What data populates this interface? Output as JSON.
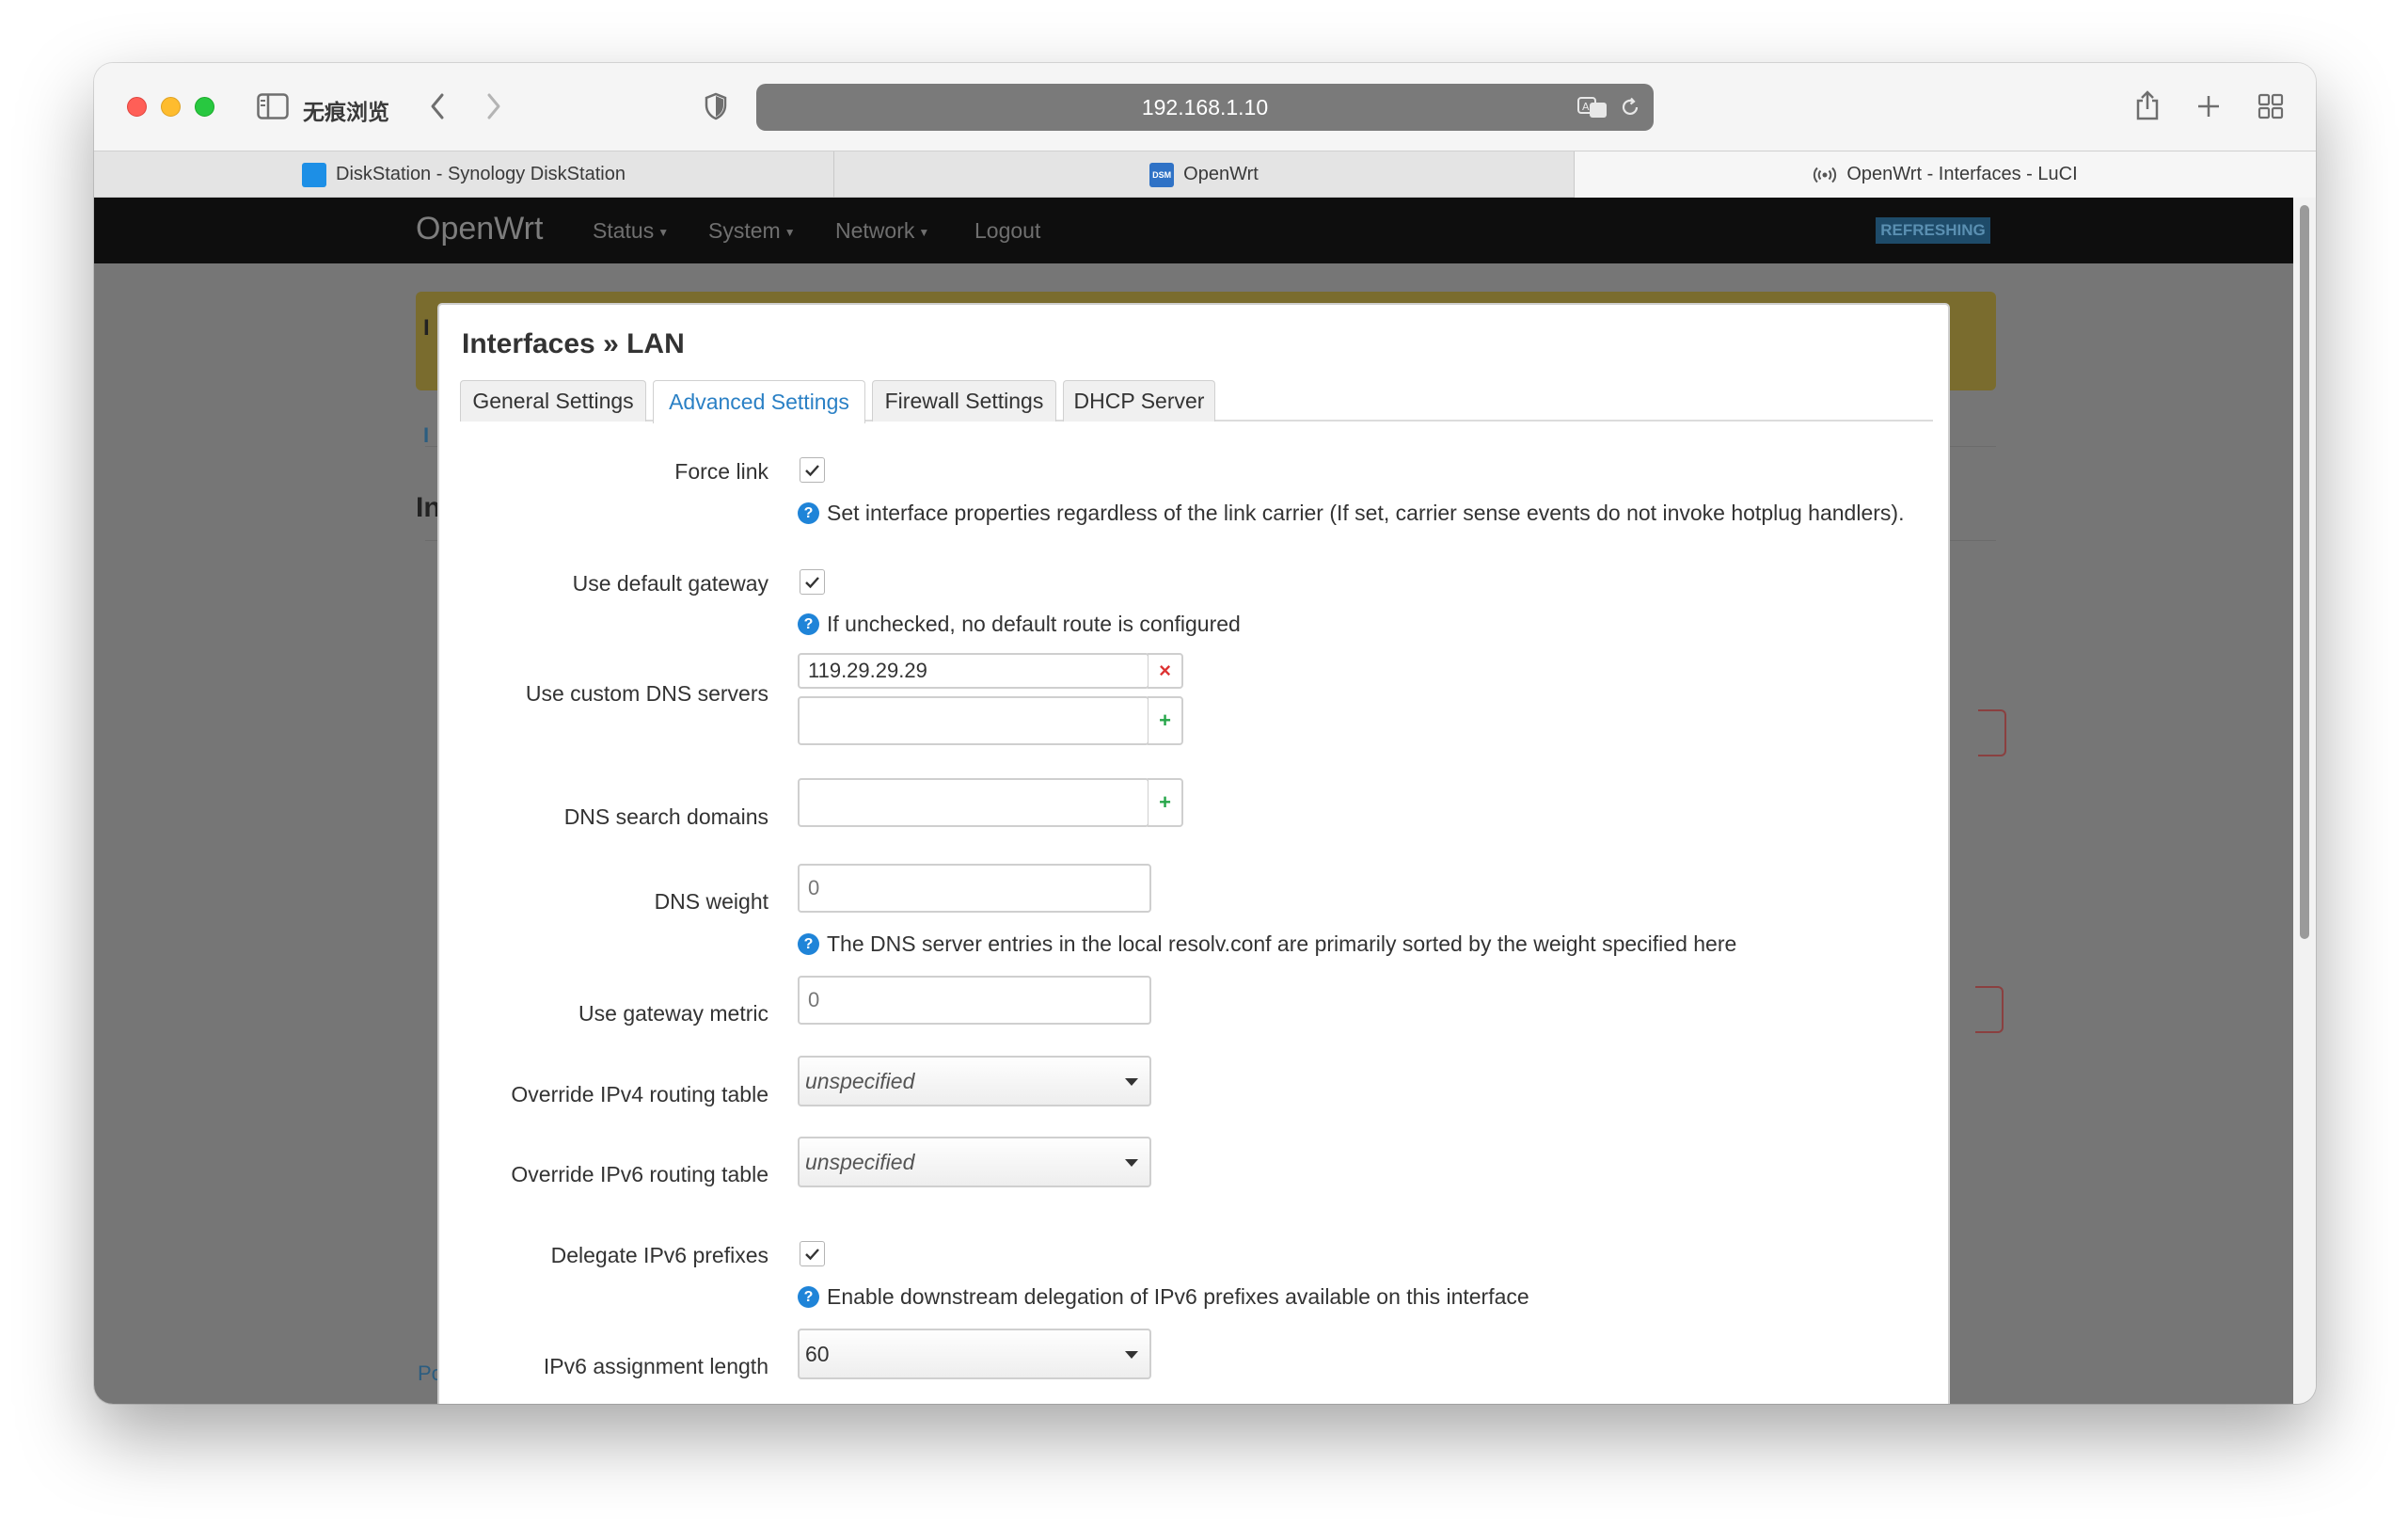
{
  "browser": {
    "private_label": "无痕浏览",
    "address": "192.168.1.10",
    "tabs": [
      {
        "label": "DiskStation - Synology DiskStation",
        "favicon": "synology-icon"
      },
      {
        "label": "OpenWrt",
        "favicon": "dsm-icon",
        "favicon_text": "DSM"
      },
      {
        "label": "OpenWrt - Interfaces - LuCI",
        "favicon": "broadcast-icon"
      }
    ]
  },
  "openwrt": {
    "brand": "OpenWrt",
    "menu": [
      {
        "label": "Status"
      },
      {
        "label": "System"
      },
      {
        "label": "Network"
      },
      {
        "label": "Logout"
      }
    ],
    "refresh_badge": "REFRESHING",
    "background_letters": {
      "a": "I",
      "b": "I",
      "c": "In",
      "d": "Po"
    }
  },
  "modal": {
    "title": "Interfaces » LAN",
    "tabs": [
      {
        "label": "General Settings"
      },
      {
        "label": "Advanced Settings"
      },
      {
        "label": "Firewall Settings"
      },
      {
        "label": "DHCP Server"
      }
    ],
    "active_tab": "Advanced Settings",
    "fields": {
      "force_link": {
        "label": "Force link",
        "checked": true,
        "help": "Set interface properties regardless of the link carrier (If set, carrier sense events do not invoke hotplug handlers)."
      },
      "default_gateway": {
        "label": "Use default gateway",
        "checked": true,
        "help": "If unchecked, no default route is configured"
      },
      "custom_dns": {
        "label": "Use custom DNS servers",
        "values": [
          "119.29.29.29"
        ],
        "new_value": ""
      },
      "dns_search": {
        "label": "DNS search domains",
        "new_value": ""
      },
      "dns_weight": {
        "label": "DNS weight",
        "placeholder": "0",
        "help": "The DNS server entries in the local resolv.conf are primarily sorted by the weight specified here"
      },
      "gateway_metric": {
        "label": "Use gateway metric",
        "placeholder": "0"
      },
      "ipv4_table": {
        "label": "Override IPv4 routing table",
        "value": "unspecified"
      },
      "ipv6_table": {
        "label": "Override IPv6 routing table",
        "value": "unspecified"
      },
      "delegate_ipv6": {
        "label": "Delegate IPv6 prefixes",
        "checked": true,
        "help": "Enable downstream delegation of IPv6 prefixes available on this interface"
      },
      "ipv6_assign_len": {
        "label": "IPv6 assignment length",
        "value": "60"
      }
    }
  },
  "colors": {
    "accent": "#2a80c5",
    "help_icon": "#1f84d8",
    "remove": "#dd3333",
    "add": "#27a64a"
  }
}
